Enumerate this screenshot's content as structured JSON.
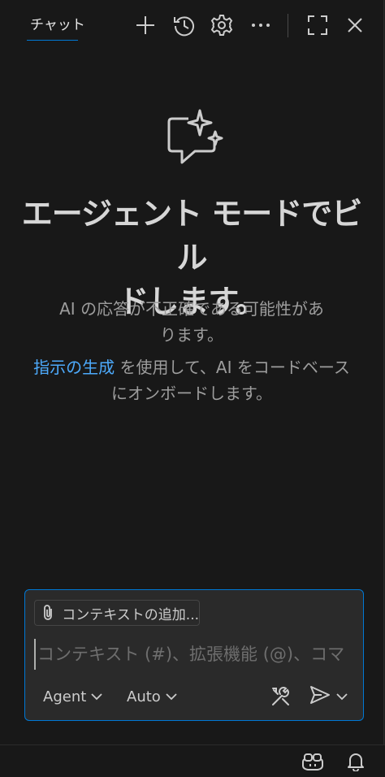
{
  "header": {
    "tab_label": "チャット",
    "actions": [
      {
        "name": "new-chat-icon"
      },
      {
        "name": "history-icon"
      },
      {
        "name": "settings-gear-icon"
      },
      {
        "name": "more-icon"
      },
      {
        "name": "maximize-icon"
      },
      {
        "name": "close-icon"
      }
    ]
  },
  "welcome": {
    "icon": "chat-sparkle-icon",
    "heading_line1": "エージェント モードでビル",
    "heading_line2": "ドします。",
    "disclaimer_line1": "AI の応答が不正確である可能性があ",
    "disclaimer_line2": "ります。",
    "onboard_link": "指示の生成",
    "onboard_rest": " を使用して、AI をコードベース",
    "onboard_line2": "にオンボードします。"
  },
  "input": {
    "context_chip_label": "コンテキストの追加...",
    "placeholder": "コンテキスト (#)、拡張機能 (@)、コマ",
    "mode_label": "Agent",
    "model_label": "Auto"
  },
  "colors": {
    "accent": "#0078d4",
    "link": "#4daafc",
    "panel_bg": "#181818",
    "input_bg": "#2a2a2a"
  }
}
